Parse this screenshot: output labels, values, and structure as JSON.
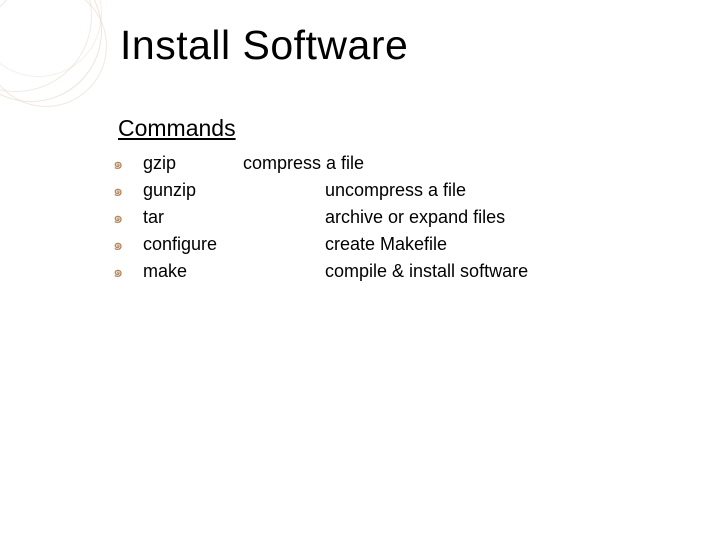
{
  "title": "Install Software",
  "subhead": "Commands",
  "bullet": "๑",
  "items": [
    {
      "cmd": "gzip",
      "desc": "compress a file",
      "style": "first"
    },
    {
      "cmd": "gunzip",
      "desc": "uncompress a file",
      "style": "rest"
    },
    {
      "cmd": "tar",
      "desc": "archive or expand files",
      "style": "rest"
    },
    {
      "cmd": "configure",
      "desc": "create Makefile",
      "style": "rest"
    },
    {
      "cmd": "make",
      "desc": "compile & install software",
      "style": "rest"
    }
  ]
}
